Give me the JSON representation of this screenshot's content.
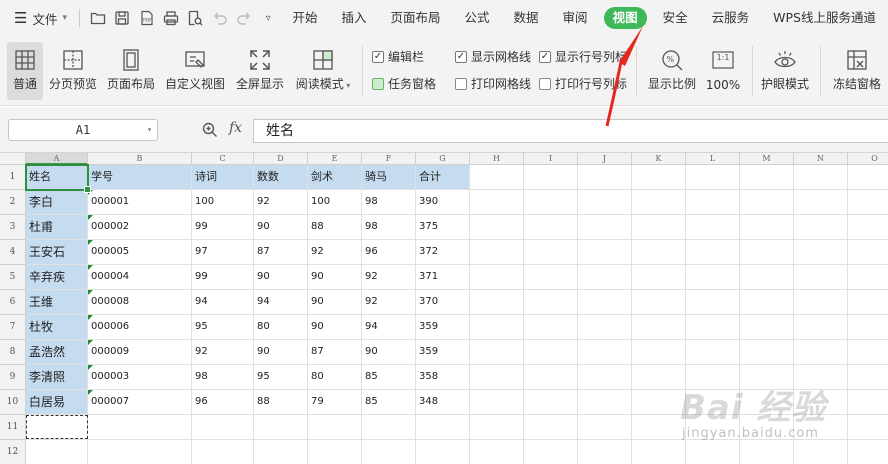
{
  "menubar": {
    "file_label": "文件",
    "tabs": [
      "开始",
      "插入",
      "页面布局",
      "公式",
      "数据",
      "审阅",
      "视图",
      "安全",
      "云服务",
      "WPS线上服务通道"
    ],
    "active_tab": "视图",
    "active_color": "#3fb85a"
  },
  "ribbon": {
    "buttons": [
      "普通",
      "分页预览",
      "页面布局",
      "自定义视图",
      "全屏显示",
      "阅读模式"
    ],
    "checks": [
      {
        "label": "编辑栏",
        "checked": true
      },
      {
        "label": "任务窗格",
        "checked": false
      },
      {
        "label": "显示网格线",
        "checked": true
      },
      {
        "label": "打印网格线",
        "checked": false
      },
      {
        "label": "显示行号列标",
        "checked": true
      },
      {
        "label": "打印行号列标",
        "checked": false
      }
    ],
    "zoom_label": "显示比例",
    "zoom_value": "100%",
    "zoom_ratio": "1:1",
    "eye_label": "护眼模式",
    "freeze_label": "冻结窗格"
  },
  "formula_bar": {
    "cell_ref": "A1",
    "fx": "fx",
    "content": "姓名"
  },
  "sheet": {
    "columns": [
      "A",
      "B",
      "C",
      "D",
      "E",
      "F",
      "G",
      "H",
      "I",
      "J",
      "K",
      "L",
      "M",
      "N",
      "O"
    ],
    "row_numbers": [
      "1",
      "2",
      "3",
      "4",
      "5",
      "6",
      "7",
      "8",
      "9",
      "10",
      "11",
      "12"
    ],
    "headers": [
      "姓名",
      "学号",
      "诗词",
      "数数",
      "剑术",
      "骑马",
      "合计"
    ],
    "rows": [
      [
        "李白",
        "000001",
        "100",
        "92",
        "100",
        "98",
        "390"
      ],
      [
        "杜甫",
        "000002",
        "99",
        "90",
        "88",
        "98",
        "375"
      ],
      [
        "王安石",
        "000005",
        "97",
        "87",
        "92",
        "96",
        "372"
      ],
      [
        "辛弃疾",
        "000004",
        "99",
        "90",
        "90",
        "92",
        "371"
      ],
      [
        "王维",
        "000008",
        "94",
        "94",
        "90",
        "92",
        "370"
      ],
      [
        "杜牧",
        "000006",
        "95",
        "80",
        "90",
        "94",
        "359"
      ],
      [
        "孟浩然",
        "000009",
        "92",
        "90",
        "87",
        "90",
        "359"
      ],
      [
        "李清照",
        "000003",
        "98",
        "95",
        "80",
        "85",
        "358"
      ],
      [
        "白居易",
        "000007",
        "96",
        "88",
        "79",
        "85",
        "348"
      ]
    ],
    "selected_cell": "A1",
    "highlight_color": "#c5dbef"
  },
  "watermark": {
    "logo": "Bai 经验",
    "url": "jingyan.baidu.com"
  }
}
